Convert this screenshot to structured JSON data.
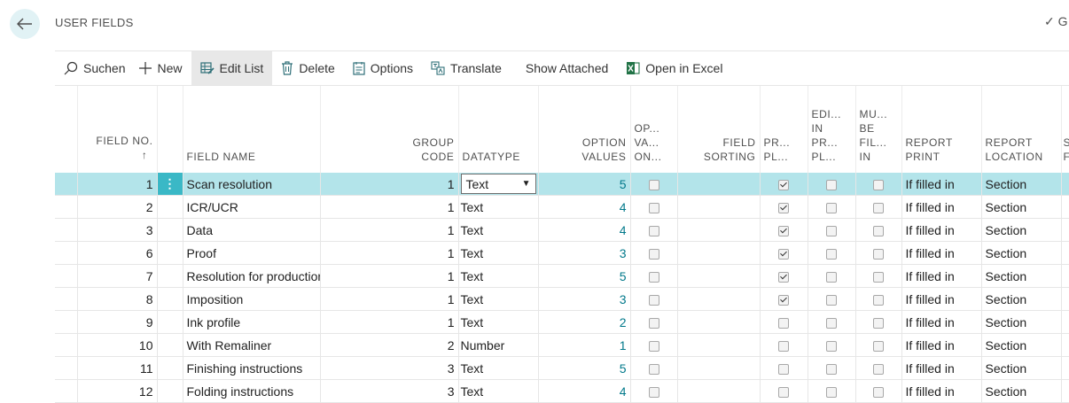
{
  "page": {
    "title": "USER FIELDS",
    "top_right": "✓ G"
  },
  "actions": [
    {
      "label": "Suchen",
      "icon": "search-icon"
    },
    {
      "label": "New",
      "icon": "plus-icon"
    },
    {
      "label": "Edit List",
      "icon": "edit-list-icon"
    },
    {
      "label": "Delete",
      "icon": "trash-icon"
    },
    {
      "label": "Options",
      "icon": "options-icon"
    },
    {
      "label": "Translate",
      "icon": "translate-icon"
    },
    {
      "label": "Show Attached",
      "icon": ""
    },
    {
      "label": "Open in Excel",
      "icon": "excel-icon"
    }
  ],
  "columns": {
    "field_no": "FIELD NO.",
    "sort_indicator": "↑",
    "field_name": "FIELD NAME",
    "group_code_1": "GROUP",
    "group_code_2": "CODE",
    "datatype": "DATATYPE",
    "option_values_1": "OPTION",
    "option_values_2": "VALUES",
    "op_va_on_1": "OP...",
    "op_va_on_2": "VA...",
    "op_va_on_3": "ON...",
    "field_sorting_1": "FIELD",
    "field_sorting_2": "SORTING",
    "pr_pl_1": "PR...",
    "pr_pl_2": "PL...",
    "edi_1": "EDI...",
    "edi_2": "IN",
    "edi_3": "PR...",
    "edi_4": "PL...",
    "mu_1": "MU...",
    "mu_2": "BE",
    "mu_3": "FIL...",
    "mu_4": "IN",
    "report_print_1": "REPORT",
    "report_print_2": "PRINT",
    "report_location_1": "REPORT",
    "report_location_2": "LOCATION",
    "extra_1": "S",
    "extra_2": "F"
  },
  "rows": [
    {
      "field_no": "1",
      "name": "Scan resolution",
      "group": "1",
      "datatype": "Text",
      "options": "5",
      "pr_pl": true,
      "report_print": "If filled in",
      "report_location": "Section"
    },
    {
      "field_no": "2",
      "name": "ICR/UCR",
      "group": "1",
      "datatype": "Text",
      "options": "4",
      "pr_pl": true,
      "report_print": "If filled in",
      "report_location": "Section"
    },
    {
      "field_no": "3",
      "name": "Data",
      "group": "1",
      "datatype": "Text",
      "options": "4",
      "pr_pl": true,
      "report_print": "If filled in",
      "report_location": "Section"
    },
    {
      "field_no": "6",
      "name": "Proof",
      "group": "1",
      "datatype": "Text",
      "options": "3",
      "pr_pl": true,
      "report_print": "If filled in",
      "report_location": "Section"
    },
    {
      "field_no": "7",
      "name": "Resolution for production",
      "group": "1",
      "datatype": "Text",
      "options": "5",
      "pr_pl": true,
      "report_print": "If filled in",
      "report_location": "Section"
    },
    {
      "field_no": "8",
      "name": "Imposition",
      "group": "1",
      "datatype": "Text",
      "options": "3",
      "pr_pl": true,
      "report_print": "If filled in",
      "report_location": "Section"
    },
    {
      "field_no": "9",
      "name": "Ink profile",
      "group": "1",
      "datatype": "Text",
      "options": "2",
      "pr_pl": false,
      "report_print": "If filled in",
      "report_location": "Section"
    },
    {
      "field_no": "10",
      "name": "With Remaliner",
      "group": "2",
      "datatype": "Number",
      "options": "1",
      "pr_pl": false,
      "report_print": "If filled in",
      "report_location": "Section"
    },
    {
      "field_no": "11",
      "name": "Finishing instructions",
      "group": "3",
      "datatype": "Text",
      "options": "5",
      "pr_pl": false,
      "report_print": "If filled in",
      "report_location": "Section"
    },
    {
      "field_no": "12",
      "name": "Folding instructions",
      "group": "3",
      "datatype": "Text",
      "options": "4",
      "pr_pl": false,
      "report_print": "If filled in",
      "report_location": "Section"
    }
  ],
  "colors": {
    "accent": "#00788a",
    "selected_row": "#b3e4ea",
    "row_handle": "#3ab8c6"
  }
}
